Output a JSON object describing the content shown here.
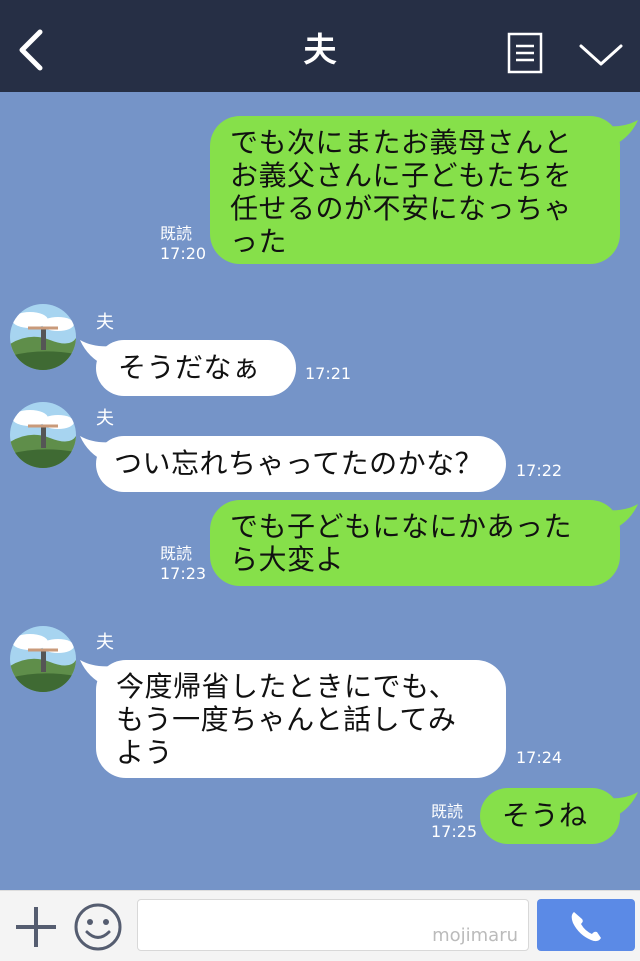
{
  "header": {
    "title": "夫"
  },
  "messages": [
    {
      "type": "out",
      "text_lines": [
        "でも次にまたお義母さんと",
        "お義父さんに子どもたちを",
        "任せるのが不安になっちゃ",
        "った"
      ],
      "read": "既読",
      "time": "17:20"
    },
    {
      "type": "in",
      "sender": "夫",
      "text_lines": [
        "そうだなぁ"
      ],
      "time": "17:21"
    },
    {
      "type": "in",
      "sender": "夫",
      "text_lines": [
        "つい忘れちゃってたのかな？"
      ],
      "time": "17:22"
    },
    {
      "type": "out",
      "text_lines": [
        "でも子どもになにかあった",
        "ら大変よ"
      ],
      "read": "既読",
      "time": "17:23"
    },
    {
      "type": "in",
      "sender": "夫",
      "text_lines": [
        "今度帰省したときにでも、",
        "もう一度ちゃんと話してみ",
        "よう"
      ],
      "time": "17:24"
    },
    {
      "type": "out",
      "text_lines": [
        "そうね"
      ],
      "read": "既読",
      "time": "17:25"
    }
  ],
  "footer": {
    "input_placeholder": "",
    "watermark": "mojimaru"
  },
  "colors": {
    "header_bg": "#262f45",
    "chat_bg": "#7594c8",
    "outgoing_bubble": "#86e04a",
    "incoming_bubble": "#ffffff",
    "call_button": "#5b8ae6"
  },
  "icons": {
    "back": "chevron-left-icon",
    "menu": "document-list-icon",
    "expand": "chevron-down-icon",
    "plus": "plus-icon",
    "emoji": "smiley-icon",
    "call": "phone-icon"
  }
}
